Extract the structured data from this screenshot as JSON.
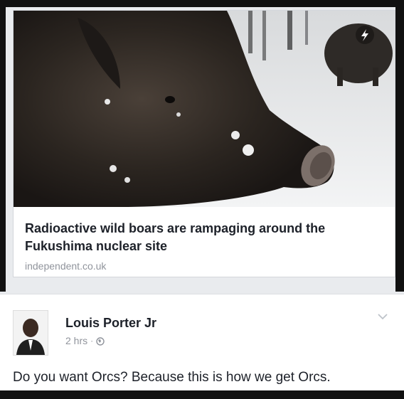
{
  "link_preview": {
    "image": "wild-boar-in-snow-photo",
    "badge_icon": "lightning-bolt-icon",
    "headline": "Radioactive wild boars are rampaging around the Fukushima nuclear site",
    "domain": "independent.co.uk"
  },
  "comment": {
    "author": "Louis Porter Jr",
    "time": "2 hrs",
    "separator": "·",
    "privacy_icon": "globe-icon",
    "menu_icon": "chevron-down-icon",
    "text": "Do you want Orcs? Because this is how we get Orcs."
  }
}
